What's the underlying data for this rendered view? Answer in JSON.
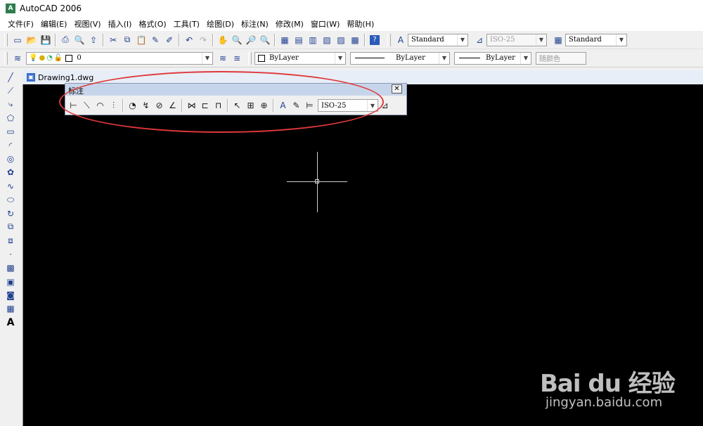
{
  "window": {
    "title": "AutoCAD 2006",
    "logo_text": "A"
  },
  "menu": [
    "文件(F)",
    "编辑(E)",
    "视图(V)",
    "插入(I)",
    "格式(O)",
    "工具(T)",
    "绘图(D)",
    "标注(N)",
    "修改(M)",
    "窗口(W)",
    "帮助(H)"
  ],
  "toolbar1": {
    "text_style": "Standard",
    "dim_style": "ISO-25",
    "table_style": "Standard"
  },
  "toolbar2": {
    "layer": "0",
    "color": "ByLayer",
    "linetype": "ByLayer",
    "lineweight": "ByLayer",
    "plotstyle": "随颜色"
  },
  "drawing": {
    "tab_label": "Drawing1.dwg"
  },
  "dim_toolbar": {
    "title": "标注",
    "close_label": "✕",
    "style_value": "ISO-25"
  },
  "watermark": {
    "logo": "Bai du 经验",
    "url": "jingyan.baidu.com"
  },
  "colors": {
    "annotation": "#e0383b",
    "canvas": "#000000",
    "crosshair": "#cfcfcf"
  }
}
